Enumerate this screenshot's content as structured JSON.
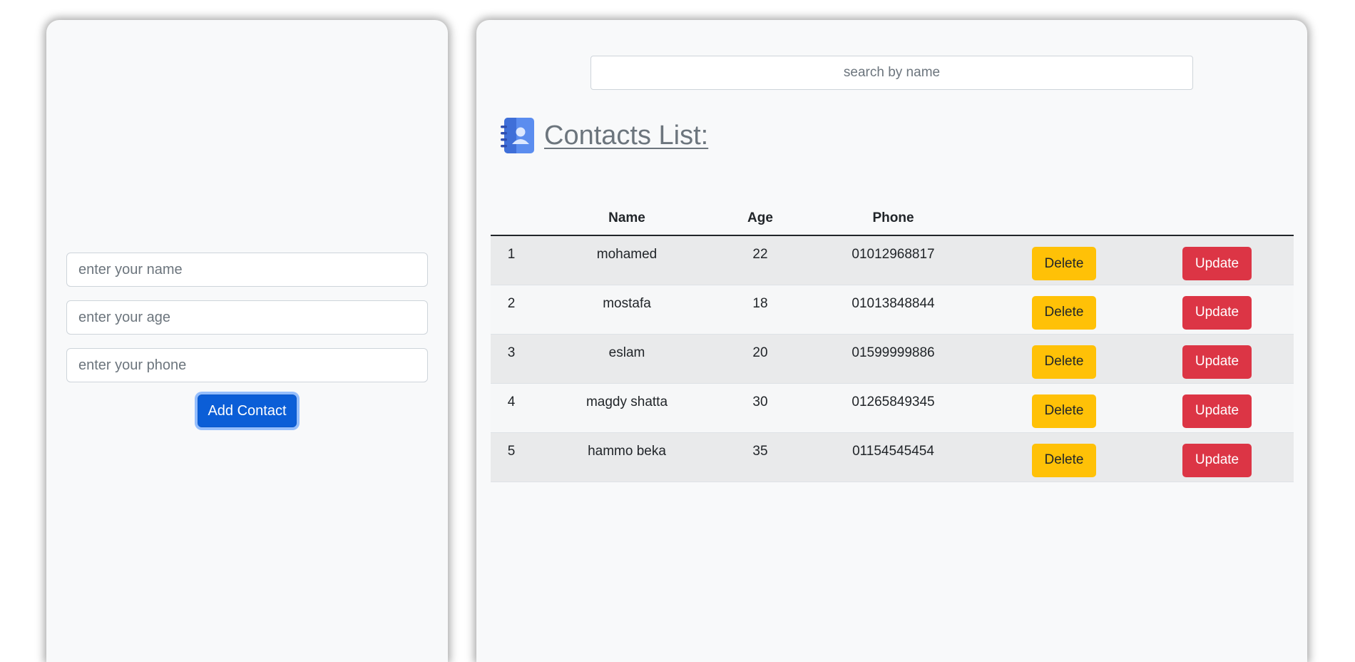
{
  "form": {
    "name_placeholder": "enter your name",
    "age_placeholder": "enter your age",
    "phone_placeholder": "enter your phone",
    "add_label": "Add Contact"
  },
  "search": {
    "placeholder": "search by name"
  },
  "list": {
    "title": "Contacts List:",
    "icon": "contact-book-icon",
    "columns": [
      "",
      "Name",
      "Age",
      "Phone",
      "",
      ""
    ],
    "delete_label": "Delete",
    "update_label": "Update",
    "rows": [
      {
        "index": "1",
        "name": "mohamed",
        "age": "22",
        "phone": "01012968817"
      },
      {
        "index": "2",
        "name": "mostafa",
        "age": "18",
        "phone": "01013848844"
      },
      {
        "index": "3",
        "name": "eslam",
        "age": "20",
        "phone": "01599999886"
      },
      {
        "index": "4",
        "name": "magdy shatta",
        "age": "30",
        "phone": "01265849345"
      },
      {
        "index": "5",
        "name": "hammo beka",
        "age": "35",
        "phone": "01154545454"
      }
    ]
  },
  "colors": {
    "primary": "#0b5ed7",
    "warning": "#ffc107",
    "danger": "#dc3545",
    "panel": "#f8f9fa"
  }
}
